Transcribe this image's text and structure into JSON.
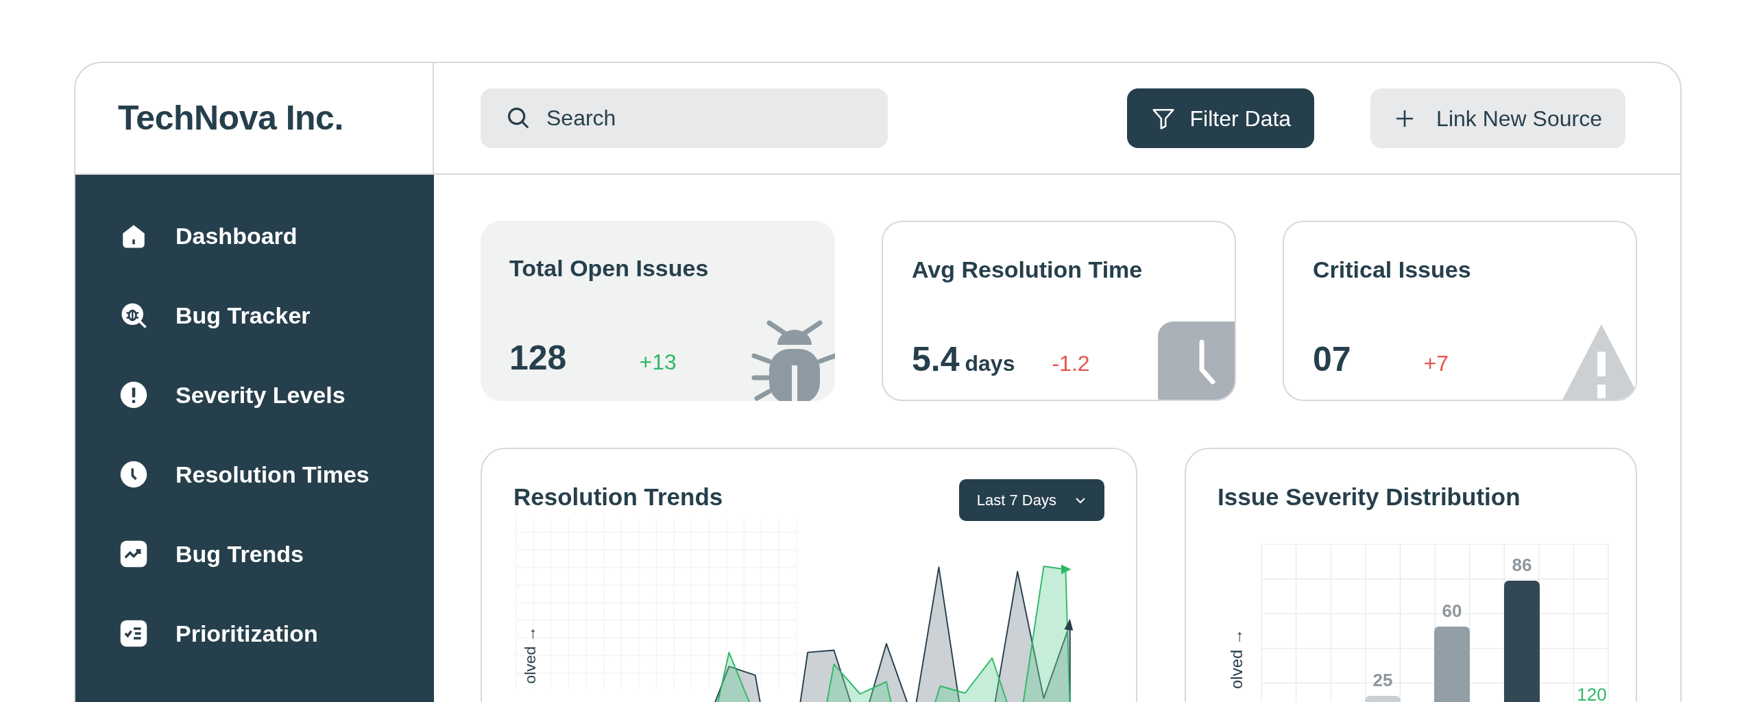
{
  "brand": "TechNova Inc.",
  "search": {
    "placeholder": "Search"
  },
  "buttons": [
    {
      "label": "Filter Data",
      "kind": "primary"
    },
    {
      "label": "Link New Source",
      "kind": "secondary"
    }
  ],
  "sidebar": {
    "items": [
      {
        "label": "Dashboard"
      },
      {
        "label": "Bug Tracker"
      },
      {
        "label": "Severity Levels"
      },
      {
        "label": "Resolution Times"
      },
      {
        "label": "Bug Trends"
      },
      {
        "label": "Prioritization"
      }
    ]
  },
  "stats": [
    {
      "title": "Total Open Issues",
      "value": "128",
      "delta": "+13",
      "color": "#2fb866",
      "kind": "filled"
    },
    {
      "title": "Avg Resolution Time",
      "value": "5.4",
      "unit": "days",
      "delta": "-1.2",
      "color": "#e5534b",
      "kind": "outlined"
    },
    {
      "title": "Critical Issues",
      "value": "07",
      "delta": "+7",
      "color": "#e5534b",
      "kind": "outlined"
    }
  ],
  "resolution_trends": {
    "title": "Resolution Trends",
    "range": "Last 7 Days",
    "axis_label": "olved →"
  },
  "severity_distribution": {
    "title": "Issue Severity Distribution",
    "axis_label": "olved →",
    "bar_labels": [
      "25",
      "60",
      "86"
    ],
    "side_value": "120"
  }
}
